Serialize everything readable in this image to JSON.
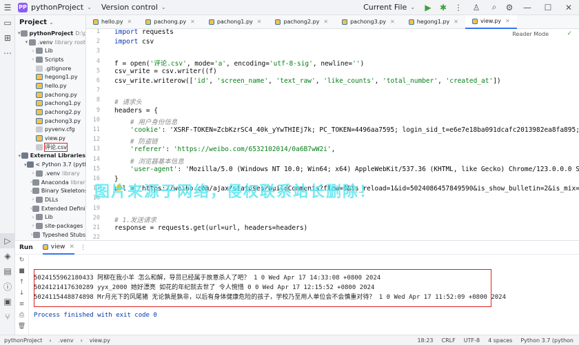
{
  "titlebar": {
    "project_badge": "PP",
    "project_name": "pythonProject",
    "vcs": "Version control",
    "run_config": "Current File"
  },
  "project_panel": {
    "title": "Project",
    "items": [
      {
        "label": "pythonProject",
        "suffix": "D:\\pyth",
        "depth": 0,
        "type": "folder",
        "arrow": "▾"
      },
      {
        "label": ".venv",
        "suffix": "library root",
        "depth": 1,
        "type": "folder",
        "arrow": "▾"
      },
      {
        "label": "Lib",
        "suffix": "",
        "depth": 2,
        "type": "folder",
        "arrow": "›"
      },
      {
        "label": "Scripts",
        "suffix": "",
        "depth": 2,
        "type": "folder",
        "arrow": "›"
      },
      {
        "label": ".gitignore",
        "suffix": "",
        "depth": 2,
        "type": "file",
        "arrow": ""
      },
      {
        "label": "hegong1.py",
        "suffix": "",
        "depth": 2,
        "type": "py",
        "arrow": ""
      },
      {
        "label": "hello.py",
        "suffix": "",
        "depth": 2,
        "type": "py",
        "arrow": ""
      },
      {
        "label": "pachong.py",
        "suffix": "",
        "depth": 2,
        "type": "py",
        "arrow": ""
      },
      {
        "label": "pachong1.py",
        "suffix": "",
        "depth": 2,
        "type": "py",
        "arrow": ""
      },
      {
        "label": "pachong2.py",
        "suffix": "",
        "depth": 2,
        "type": "py",
        "arrow": ""
      },
      {
        "label": "pachong3.py",
        "suffix": "",
        "depth": 2,
        "type": "py",
        "arrow": ""
      },
      {
        "label": "pyvenv.cfg",
        "suffix": "",
        "depth": 2,
        "type": "file",
        "arrow": ""
      },
      {
        "label": "view.py",
        "suffix": "",
        "depth": 2,
        "type": "py",
        "arrow": ""
      },
      {
        "label": "评论.csv",
        "suffix": "",
        "depth": 2,
        "type": "file",
        "arrow": "",
        "highlight": true
      },
      {
        "label": "External Libraries",
        "suffix": "",
        "depth": 0,
        "type": "lib",
        "arrow": "▾"
      },
      {
        "label": "< Python 3.7 (pytho",
        "suffix": "",
        "depth": 1,
        "type": "lib",
        "arrow": "▾"
      },
      {
        "label": ".venv",
        "suffix": "library",
        "depth": 2,
        "type": "folder",
        "arrow": "›"
      },
      {
        "label": "Anaconda",
        "suffix": "library",
        "depth": 2,
        "type": "folder",
        "arrow": "›"
      },
      {
        "label": "Binary Skeletons",
        "suffix": "",
        "depth": 2,
        "type": "folder",
        "arrow": "›"
      },
      {
        "label": "DLLs",
        "suffix": "",
        "depth": 2,
        "type": "folder",
        "arrow": "›"
      },
      {
        "label": "Extended Definiti",
        "suffix": "",
        "depth": 2,
        "type": "folder",
        "arrow": "›"
      },
      {
        "label": "Lib",
        "suffix": "",
        "depth": 2,
        "type": "folder",
        "arrow": "›"
      },
      {
        "label": "site-packages",
        "suffix": "",
        "depth": 2,
        "type": "folder",
        "arrow": "›"
      },
      {
        "label": "Typeshed Stubs",
        "suffix": "",
        "depth": 2,
        "type": "folder",
        "arrow": "›"
      }
    ]
  },
  "tabs": [
    {
      "label": "hello.py",
      "active": false
    },
    {
      "label": "pachong.py",
      "active": false
    },
    {
      "label": "pachong1.py",
      "active": false
    },
    {
      "label": "pachong2.py",
      "active": false
    },
    {
      "label": "pachong3.py",
      "active": false
    },
    {
      "label": "hegong1.py",
      "active": false
    },
    {
      "label": "view.py",
      "active": true
    }
  ],
  "editor": {
    "reader_mode": "Reader Mode",
    "line_numbers": [
      "1",
      "2",
      "3",
      "4",
      "5",
      "6",
      "7",
      "8",
      "9",
      "10",
      "11",
      "12",
      "13",
      "14",
      "15",
      "16",
      "17",
      "18",
      "19",
      "20",
      "21",
      "22"
    ],
    "lines": [
      "import requests",
      "import csv",
      "",
      "f = open('评论.csv', mode='a', encoding='utf-8-sig', newline='')",
      "csv_write = csv.writer((f)",
      "csv_write.writerow(['id', 'screen_name', 'text_raw', 'like_counts', 'total_number', 'created_at'])",
      "",
      "# 请求头",
      "headers = {",
      "    # 用户身份信息",
      "    'cookie': 'XSRF-TOKEN=ZcbKzrSC4_40k_yYwTHIEj7k; PC_TOKEN=4496aa7595; login_sid_t=e6e7e18ba091dcafc2013982ea8fa895; cross_",
      "    # 防盗链",
      "    'referer': 'https://weibo.com/6532102014/0a6B7wW2i',",
      "    # 浏览器基本信息",
      "    'user-agent': 'Mozilla/5.0 (Windows NT 10.0; Win64; x64) AppleWebKit/537.36 (KHTML, like Gecko) Chrome/123.0.0.0 Safari/5",
      "}",
      "url = 'https://weibo.com/ajax/statuses/buildComments?flow=0&is_reload=1&id=5024086457849590&is_show_bulletin=2&is_mix=0&count",
      "",
      "",
      "# 1.发送请求",
      "response = requests.get(url=url, headers=headers)",
      ""
    ],
    "watermark": "图片来源于网络，侵权联系站长删除！"
  },
  "run_panel": {
    "title": "Run",
    "config_tab": "view",
    "output": [
      "5024155962180433 阿柳在我小羊 怎么和解，导员已经属于故意杀人了吧？ 1 0 Wed Apr 17 14:33:08 +0800 2024",
      "5024121417630289 yyx_2000 她好漂亮 如花的年纪就去世了 令人惋惜 0 0 Wed Apr 17 12:15:52 +0800 2024",
      "5024115448874898 Mr月光下的风尾猪 无论孰是孰非，以后有身体健康危险的孩子，学校乃至用人单位会不会慎重对待？ 1 0 Wed Apr 17 11:52:09 +0800 2024"
    ],
    "finished": "Process finished with exit code 0"
  },
  "statusbar": {
    "breadcrumb": [
      "pythonProject",
      ".venv",
      "view.py"
    ],
    "position": "18:23",
    "line_sep": "CRLF",
    "encoding": "UTF-8",
    "indent": "4 spaces",
    "interpreter": "Python 3.7 (python"
  }
}
